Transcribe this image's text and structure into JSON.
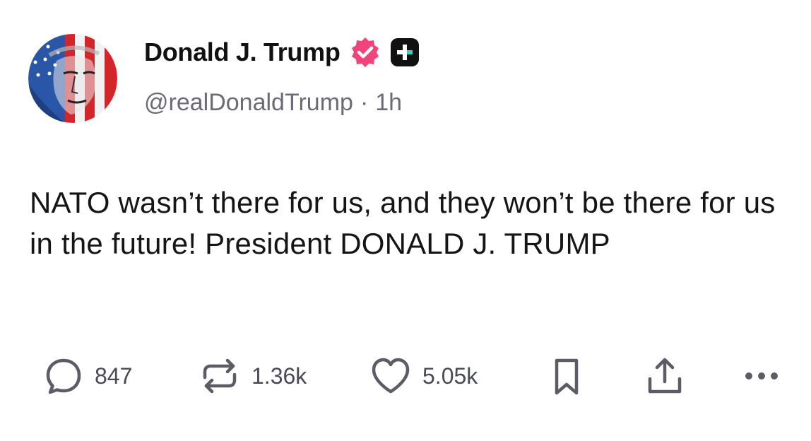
{
  "post": {
    "author": {
      "display_name": "Donald J. Trump",
      "handle": "@realDonaldTrump",
      "separator": "·",
      "time": "1h",
      "verified_icon": "verified-badge-icon",
      "platform_icon": "truth-social-plus-icon"
    },
    "content": "NATO wasn’t there for us, and they won’t be there for us in the future! President DONALD J. TRUMP",
    "actions": {
      "reply_count": "847",
      "retruth_count": "1.36k",
      "like_count": "5.05k"
    }
  },
  "colors": {
    "verified": "#f0457a",
    "text_primary": "#111111",
    "text_secondary": "#6b6b78",
    "icon": "#5c5c66"
  }
}
